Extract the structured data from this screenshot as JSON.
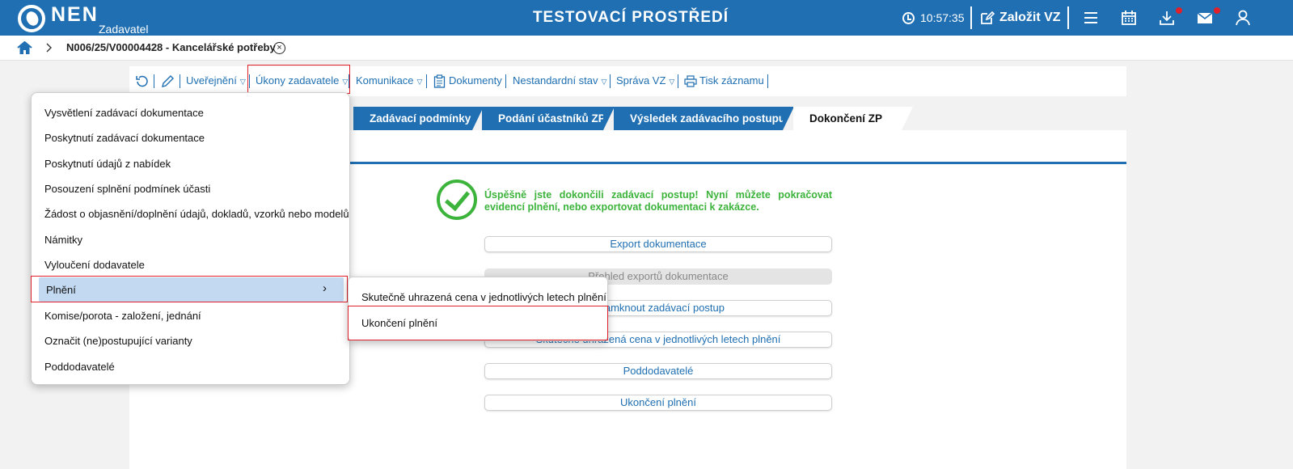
{
  "header": {
    "logo_text": "NEN",
    "logo_sub": "Zadavatel",
    "title": "TESTOVACÍ PROSTŘEDÍ",
    "time": "10:57:35",
    "create_label": "Založit VZ"
  },
  "breadcrumb": {
    "record": "N006/25/V00004428 - Kancelářské potřeby",
    "close_glyph": "×"
  },
  "toolbar": {
    "publish": "Uveřejnění",
    "actions": "Úkony zadavatele",
    "communication": "Komunikace",
    "documents": "Dokumenty",
    "nonstandard": "Nestandardní stav",
    "manage": "Správa VZ",
    "print": "Tisk záznamu",
    "triangle": "▽"
  },
  "tabs": [
    {
      "label": "Zadávací podmínky"
    },
    {
      "label": "Podání účastníků ZP"
    },
    {
      "label": "Výsledek zadávacího postupu"
    },
    {
      "label": "Dokončení ZP"
    }
  ],
  "success_message": "Úspěšně jste dokončili zadávací postup! Nyní můžete pokračovat evidencí plnění, nebo exportovat dokumentaci k zakázce.",
  "actions": [
    {
      "label": "Export dokumentace"
    },
    {
      "label": "Přehled exportů dokumentace"
    },
    {
      "label": "Uzamknout zadávací postup"
    },
    {
      "label": "Skutečně uhrazená cena v jednotlivých letech plnění"
    },
    {
      "label": "Poddodavatelé"
    },
    {
      "label": "Ukončení plnění"
    }
  ],
  "menu": {
    "items": [
      {
        "label": "Vysvětlení zadávací dokumentace"
      },
      {
        "label": "Poskytnutí zadávací dokumentace"
      },
      {
        "label": "Poskytnutí údajů z nabídek"
      },
      {
        "label": "Posouzení splnění podmínek účasti"
      },
      {
        "label": "Žádost o objasnění/doplnění údajů, dokladů, vzorků nebo modelů"
      },
      {
        "label": "Námitky"
      },
      {
        "label": "Vyloučení dodavatele"
      },
      {
        "label": "Plnění"
      },
      {
        "label": "Komise/porota - založení, jednání"
      },
      {
        "label": "Označit (ne)postupující varianty"
      },
      {
        "label": "Poddodavatelé"
      }
    ],
    "chevron": "›"
  },
  "submenu": {
    "items": [
      {
        "label": "Skutečně uhrazená cena v jednotlivých letech plnění"
      },
      {
        "label": "Ukončení plnění"
      }
    ]
  }
}
